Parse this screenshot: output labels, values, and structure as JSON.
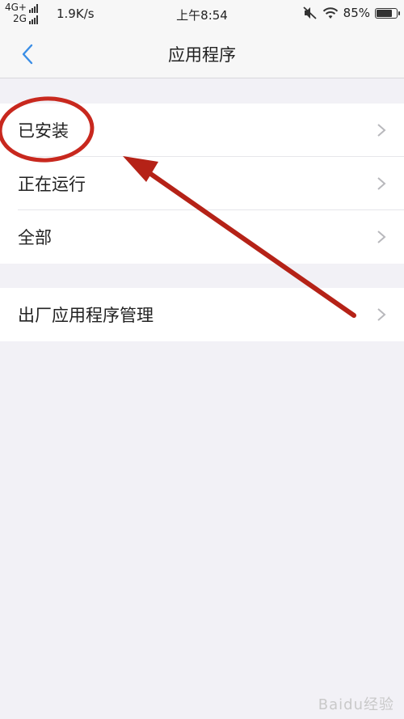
{
  "status_bar": {
    "network_top": "4G+",
    "network_bottom": "2G",
    "speed": "1.9K/s",
    "time": "上午8:54",
    "battery": "85%",
    "battery_level": 0.85,
    "icons": [
      "signal-bars-icon",
      "mute-icon",
      "wifi-icon",
      "battery-icon"
    ]
  },
  "nav": {
    "title": "应用程序",
    "back_icon": "chevron-left-icon"
  },
  "groups": [
    {
      "items": [
        {
          "label": "已安装"
        },
        {
          "label": "正在运行"
        },
        {
          "label": "全部"
        }
      ]
    },
    {
      "items": [
        {
          "label": "出厂应用程序管理"
        }
      ]
    }
  ],
  "annotation": {
    "circle_color": "#c8281e",
    "arrow_color": "#b52217"
  },
  "watermark": "Baidu经验",
  "colors": {
    "accent": "#3a8ee6",
    "background": "#f2f1f6",
    "chevron": "#b8b8bc"
  }
}
